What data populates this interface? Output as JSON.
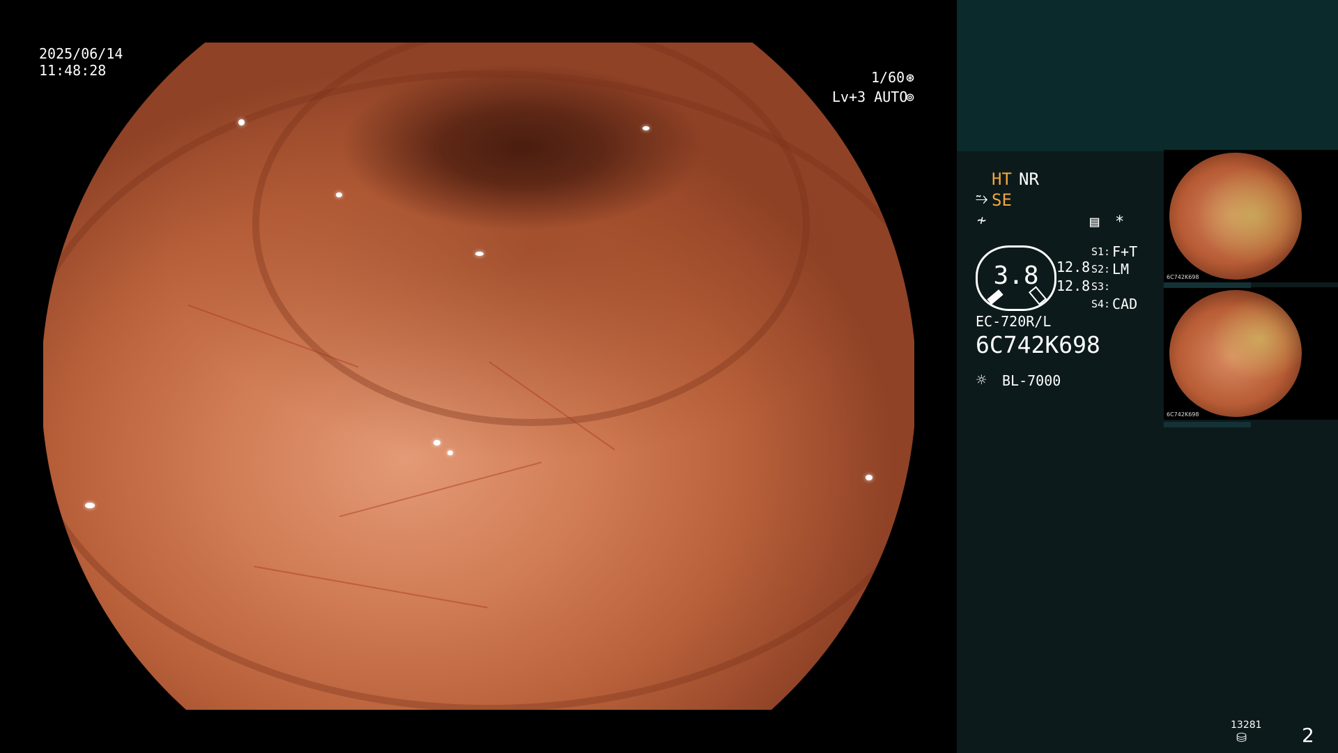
{
  "overlay": {
    "date": "2025/06/14",
    "time": "11:48:28",
    "shutter": "1/60",
    "shutter_icon": "aperture-icon",
    "level": "Lv+3 AUTO",
    "level_icon": "iris-icon"
  },
  "panel": {
    "ht_label": "HT",
    "nr_label": "NR",
    "se_label": "SE",
    "se_icon": "scope-tip-icon",
    "freeze_icon": "freeze-icon",
    "settings_icon": "menu-icon",
    "star": "*",
    "gauge_value": "3.8",
    "read_1": "12.8",
    "read_2": "12.8",
    "s1_label": "S1:",
    "s1_value": "F+T",
    "s2_label": "S2:",
    "s2_value": "LM",
    "s3_label": "S3:",
    "s3_value": "",
    "s4_label": "S4:",
    "s4_value": "CAD",
    "scope_model": "EC-720R/L",
    "serial": "6C742K698",
    "light_source": "BL-7000",
    "light_icon": "light-source-icon",
    "counter": "13281",
    "storage_icon": "storage-icon",
    "image_count": "2",
    "colors": {
      "amber": "#f2a53a",
      "panel_top": "#0a2a2c",
      "panel_body": "#0c1a1b"
    }
  },
  "thumbnails": [
    {
      "caption": "6C742K698"
    },
    {
      "caption": "6C742K698"
    }
  ]
}
